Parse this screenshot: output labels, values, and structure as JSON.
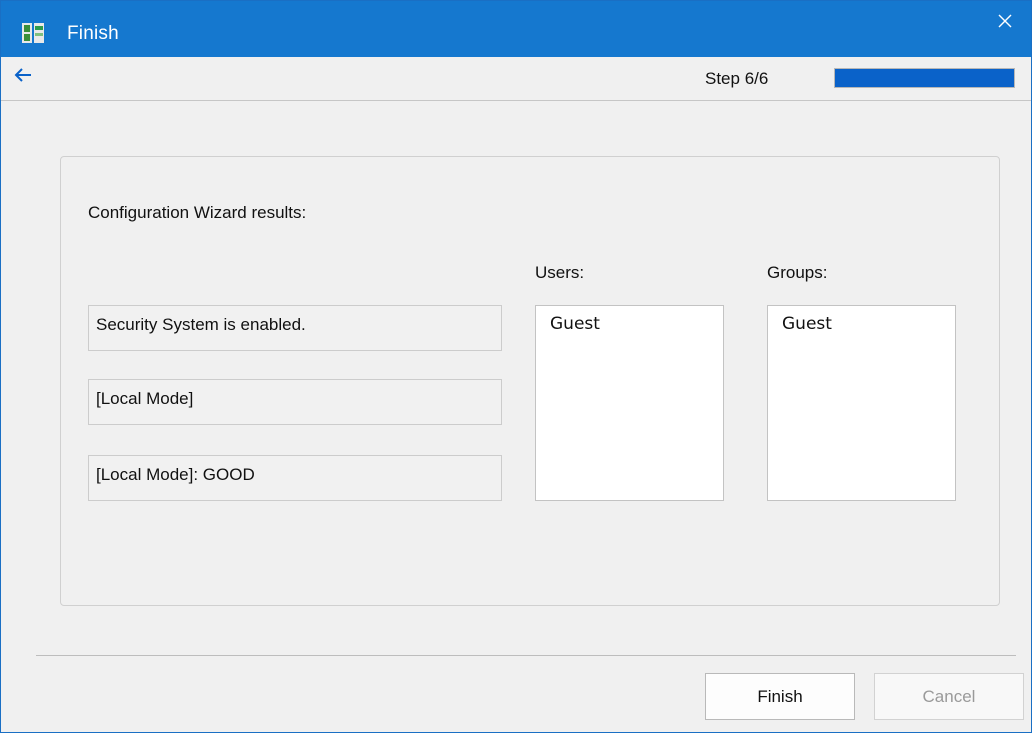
{
  "window": {
    "title": "Finish",
    "accent": "#1578cf"
  },
  "nav": {
    "step_label": "Step 6/6",
    "progress_fraction": 1.0,
    "progress_color": "#0a62c9"
  },
  "results": {
    "heading": "Configuration Wizard results:",
    "status_lines": [
      "Security System is enabled.",
      "[Local Mode]",
      "[Local Mode]: GOOD"
    ],
    "users_label": "Users:",
    "users": [
      "Guest"
    ],
    "groups_label": "Groups:",
    "groups": [
      "Guest"
    ]
  },
  "buttons": {
    "finish_label": "Finish",
    "cancel_label": "Cancel"
  },
  "icons": {
    "app": "setup-wizard-icon",
    "close": "close-icon",
    "back": "back-arrow-icon"
  }
}
